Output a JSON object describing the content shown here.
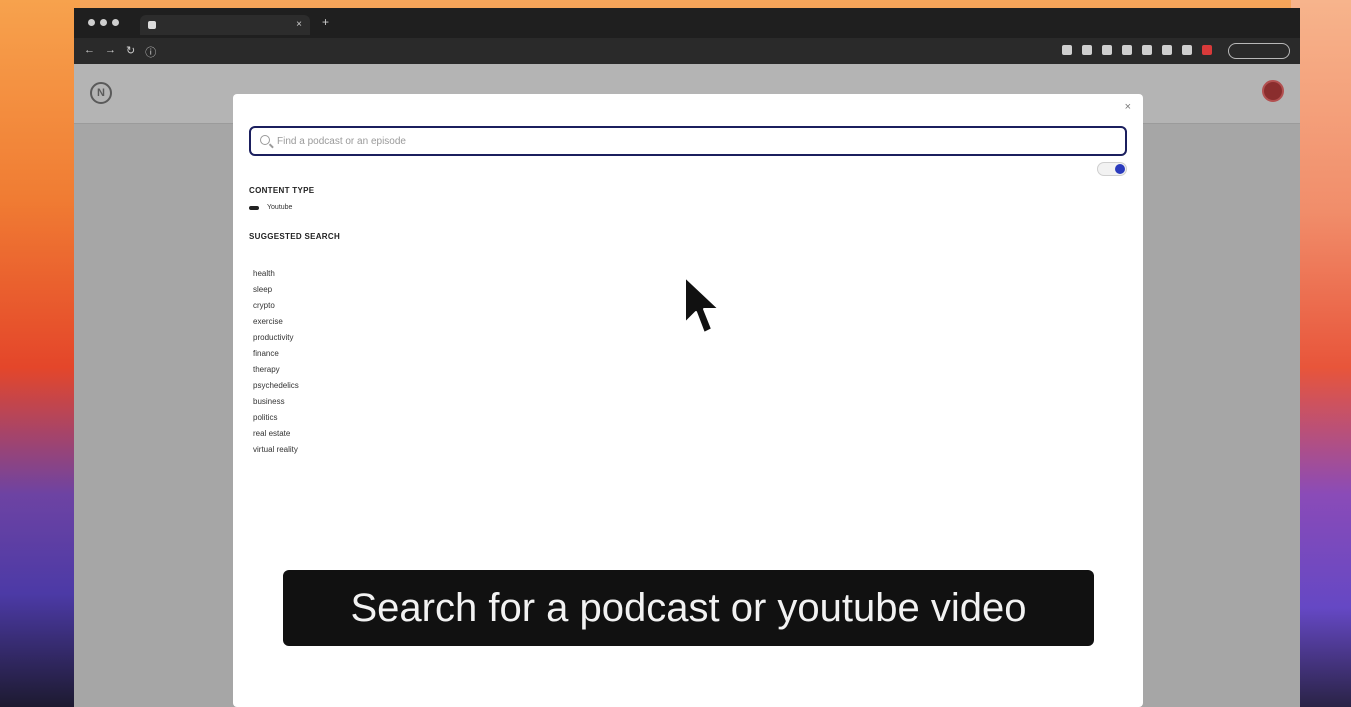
{
  "browser": {
    "tab_title": "",
    "url": "",
    "colors": {
      "chrome": "#1f1f1f",
      "accent_red": "#d93a3a"
    }
  },
  "app": {
    "nav_items": [
      "",
      "",
      "",
      ""
    ],
    "colors": {
      "avatar": "#8a2d2d"
    }
  },
  "modal": {
    "close_label": "×",
    "search": {
      "placeholder": "Find a podcast or an episode",
      "value": ""
    },
    "toggle": {
      "label": "",
      "on": true,
      "color": "#2b3bbd"
    },
    "content_type": {
      "heading": "CONTENT TYPE",
      "options": [
        {
          "label": "",
          "selected": true
        },
        {
          "label": "Youtube",
          "selected": false
        }
      ]
    },
    "suggested": {
      "heading": "SUGGESTED SEARCH",
      "hint": "",
      "items": [
        "health",
        "sleep",
        "crypto",
        "exercise",
        "productivity",
        "finance",
        "therapy",
        "psychedelics",
        "business",
        "politics",
        "real estate",
        "virtual reality"
      ]
    }
  },
  "caption": {
    "text": "Search for a podcast or youtube video"
  }
}
